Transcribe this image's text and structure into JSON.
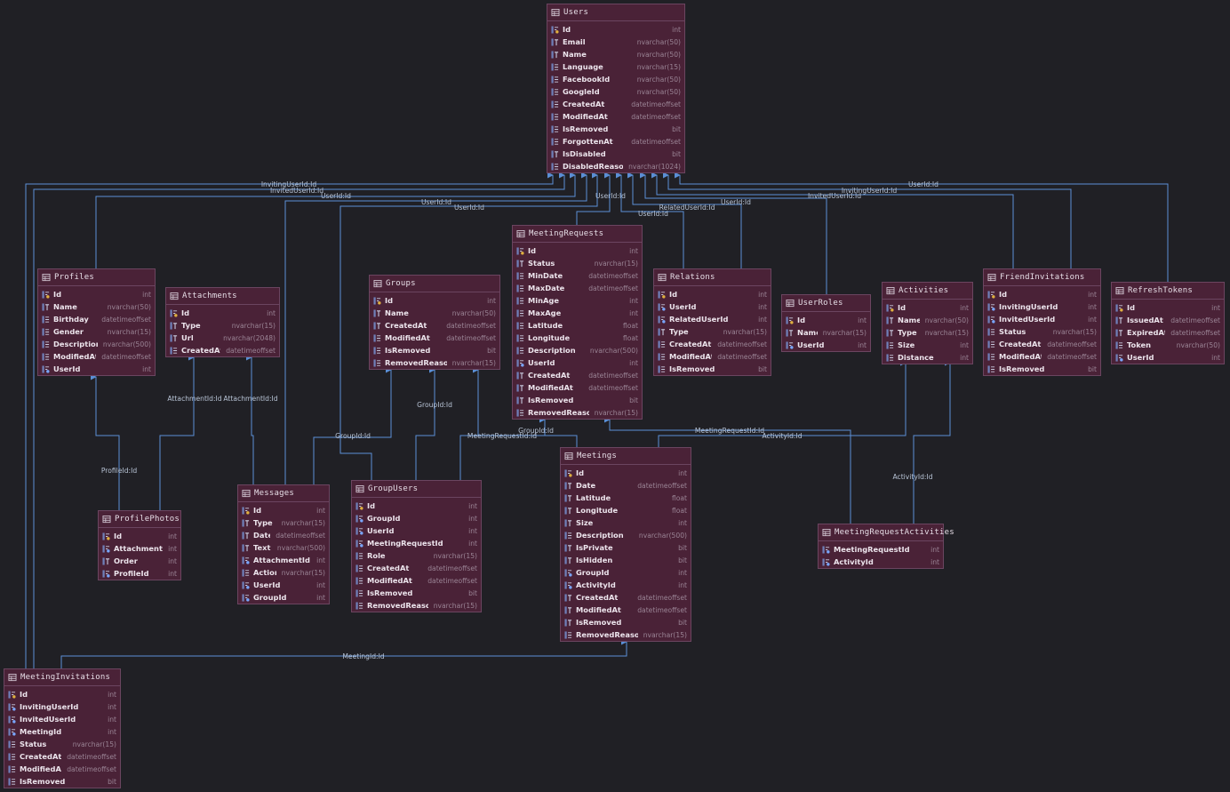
{
  "tables": [
    {
      "key": "users",
      "name": "Users",
      "columns": [
        {
          "name": "Id",
          "type": "int",
          "kind": "pk"
        },
        {
          "name": "Email",
          "type": "nvarchar(50)",
          "kind": "text"
        },
        {
          "name": "Name",
          "type": "nvarchar(50)",
          "kind": "text"
        },
        {
          "name": "Language",
          "type": "nvarchar(15)",
          "kind": "col"
        },
        {
          "name": "FacebookId",
          "type": "nvarchar(50)",
          "kind": "col"
        },
        {
          "name": "GoogleId",
          "type": "nvarchar(50)",
          "kind": "col"
        },
        {
          "name": "CreatedAt",
          "type": "datetimeoffset",
          "kind": "col"
        },
        {
          "name": "ModifiedAt",
          "type": "datetimeoffset",
          "kind": "col"
        },
        {
          "name": "IsRemoved",
          "type": "bit",
          "kind": "col"
        },
        {
          "name": "ForgottenAt",
          "type": "datetimeoffset",
          "kind": "col"
        },
        {
          "name": "IsDisabled",
          "type": "bit",
          "kind": "text"
        },
        {
          "name": "DisabledReason",
          "type": "nvarchar(1024)",
          "kind": "col"
        }
      ]
    },
    {
      "key": "meetingrequests",
      "name": "MeetingRequests",
      "columns": [
        {
          "name": "Id",
          "type": "int",
          "kind": "pk"
        },
        {
          "name": "Status",
          "type": "nvarchar(15)",
          "kind": "text"
        },
        {
          "name": "MinDate",
          "type": "datetimeoffset",
          "kind": "col"
        },
        {
          "name": "MaxDate",
          "type": "datetimeoffset",
          "kind": "col"
        },
        {
          "name": "MinAge",
          "type": "int",
          "kind": "col"
        },
        {
          "name": "MaxAge",
          "type": "int",
          "kind": "col"
        },
        {
          "name": "Latitude",
          "type": "float",
          "kind": "col"
        },
        {
          "name": "Longitude",
          "type": "float",
          "kind": "col"
        },
        {
          "name": "Description",
          "type": "nvarchar(500)",
          "kind": "col"
        },
        {
          "name": "UserId",
          "type": "int",
          "kind": "fk"
        },
        {
          "name": "CreatedAt",
          "type": "datetimeoffset",
          "kind": "text"
        },
        {
          "name": "ModifiedAt",
          "type": "datetimeoffset",
          "kind": "text"
        },
        {
          "name": "IsRemoved",
          "type": "bit",
          "kind": "text"
        },
        {
          "name": "RemovedReason",
          "type": "nvarchar(15)",
          "kind": "col"
        }
      ]
    },
    {
      "key": "profiles",
      "name": "Profiles",
      "columns": [
        {
          "name": "Id",
          "type": "int",
          "kind": "pk"
        },
        {
          "name": "Name",
          "type": "nvarchar(50)",
          "kind": "text"
        },
        {
          "name": "Birthday",
          "type": "datetimeoffset",
          "kind": "col"
        },
        {
          "name": "Gender",
          "type": "nvarchar(15)",
          "kind": "col"
        },
        {
          "name": "Description",
          "type": "nvarchar(500)",
          "kind": "col"
        },
        {
          "name": "ModifiedAt",
          "type": "datetimeoffset",
          "kind": "col"
        },
        {
          "name": "UserId",
          "type": "int",
          "kind": "fk"
        }
      ]
    },
    {
      "key": "attachments",
      "name": "Attachments",
      "columns": [
        {
          "name": "Id",
          "type": "int",
          "kind": "pk"
        },
        {
          "name": "Type",
          "type": "nvarchar(15)",
          "kind": "text"
        },
        {
          "name": "Url",
          "type": "nvarchar(2048)",
          "kind": "text"
        },
        {
          "name": "CreatedAt",
          "type": "datetimeoffset",
          "kind": "col"
        }
      ]
    },
    {
      "key": "groups",
      "name": "Groups",
      "columns": [
        {
          "name": "Id",
          "type": "int",
          "kind": "pk"
        },
        {
          "name": "Name",
          "type": "nvarchar(50)",
          "kind": "text"
        },
        {
          "name": "CreatedAt",
          "type": "datetimeoffset",
          "kind": "text"
        },
        {
          "name": "ModifiedAt",
          "type": "datetimeoffset",
          "kind": "col"
        },
        {
          "name": "IsRemoved",
          "type": "bit",
          "kind": "col"
        },
        {
          "name": "RemovedReason",
          "type": "nvarchar(15)",
          "kind": "col"
        }
      ]
    },
    {
      "key": "relations",
      "name": "Relations",
      "columns": [
        {
          "name": "Id",
          "type": "int",
          "kind": "pk"
        },
        {
          "name": "UserId",
          "type": "int",
          "kind": "fk"
        },
        {
          "name": "RelatedUserId",
          "type": "int",
          "kind": "fk"
        },
        {
          "name": "Type",
          "type": "nvarchar(15)",
          "kind": "text"
        },
        {
          "name": "CreatedAt",
          "type": "datetimeoffset",
          "kind": "col"
        },
        {
          "name": "ModifiedAt",
          "type": "datetimeoffset",
          "kind": "col"
        },
        {
          "name": "IsRemoved",
          "type": "bit",
          "kind": "col"
        }
      ]
    },
    {
      "key": "userroles",
      "name": "UserRoles",
      "columns": [
        {
          "name": "Id",
          "type": "int",
          "kind": "pk"
        },
        {
          "name": "Name",
          "type": "nvarchar(15)",
          "kind": "text"
        },
        {
          "name": "UserId",
          "type": "int",
          "kind": "fk"
        }
      ]
    },
    {
      "key": "activities",
      "name": "Activities",
      "columns": [
        {
          "name": "Id",
          "type": "int",
          "kind": "pk"
        },
        {
          "name": "Name",
          "type": "nvarchar(50)",
          "kind": "text"
        },
        {
          "name": "Type",
          "type": "nvarchar(15)",
          "kind": "text"
        },
        {
          "name": "Size",
          "type": "int",
          "kind": "col"
        },
        {
          "name": "Distance",
          "type": "int",
          "kind": "col"
        }
      ]
    },
    {
      "key": "friendinvitations",
      "name": "FriendInvitations",
      "columns": [
        {
          "name": "Id",
          "type": "int",
          "kind": "pk"
        },
        {
          "name": "InvitingUserId",
          "type": "int",
          "kind": "fk"
        },
        {
          "name": "InvitedUserId",
          "type": "int",
          "kind": "fk"
        },
        {
          "name": "Status",
          "type": "nvarchar(15)",
          "kind": "col"
        },
        {
          "name": "CreatedAt",
          "type": "datetimeoffset",
          "kind": "col"
        },
        {
          "name": "ModifiedAt",
          "type": "datetimeoffset",
          "kind": "col"
        },
        {
          "name": "IsRemoved",
          "type": "bit",
          "kind": "col"
        }
      ]
    },
    {
      "key": "refreshtokens",
      "name": "RefreshTokens",
      "columns": [
        {
          "name": "Id",
          "type": "int",
          "kind": "pk"
        },
        {
          "name": "IssuedAt",
          "type": "datetimeoffset",
          "kind": "text"
        },
        {
          "name": "ExpiredAt",
          "type": "datetimeoffset",
          "kind": "text"
        },
        {
          "name": "Token",
          "type": "nvarchar(50)",
          "kind": "col"
        },
        {
          "name": "UserId",
          "type": "int",
          "kind": "fk"
        }
      ]
    },
    {
      "key": "profilephotos",
      "name": "ProfilePhotos",
      "columns": [
        {
          "name": "Id",
          "type": "int",
          "kind": "pk"
        },
        {
          "name": "AttachmentId",
          "type": "int",
          "kind": "fk"
        },
        {
          "name": "Order",
          "type": "int",
          "kind": "text"
        },
        {
          "name": "ProfileId",
          "type": "int",
          "kind": "fk"
        }
      ]
    },
    {
      "key": "messages",
      "name": "Messages",
      "columns": [
        {
          "name": "Id",
          "type": "int",
          "kind": "pk"
        },
        {
          "name": "Type",
          "type": "nvarchar(15)",
          "kind": "text"
        },
        {
          "name": "Date",
          "type": "datetimeoffset",
          "kind": "text"
        },
        {
          "name": "Text",
          "type": "nvarchar(500)",
          "kind": "text"
        },
        {
          "name": "AttachmentId",
          "type": "int",
          "kind": "fk"
        },
        {
          "name": "Action",
          "type": "nvarchar(15)",
          "kind": "col"
        },
        {
          "name": "UserId",
          "type": "int",
          "kind": "fk"
        },
        {
          "name": "GroupId",
          "type": "int",
          "kind": "fk"
        }
      ]
    },
    {
      "key": "groupusers",
      "name": "GroupUsers",
      "columns": [
        {
          "name": "Id",
          "type": "int",
          "kind": "pk"
        },
        {
          "name": "GroupId",
          "type": "int",
          "kind": "fk"
        },
        {
          "name": "UserId",
          "type": "int",
          "kind": "fk"
        },
        {
          "name": "MeetingRequestId",
          "type": "int",
          "kind": "fk"
        },
        {
          "name": "Role",
          "type": "nvarchar(15)",
          "kind": "col"
        },
        {
          "name": "CreatedAt",
          "type": "datetimeoffset",
          "kind": "col"
        },
        {
          "name": "ModifiedAt",
          "type": "datetimeoffset",
          "kind": "col"
        },
        {
          "name": "IsRemoved",
          "type": "bit",
          "kind": "col"
        },
        {
          "name": "RemovedReason",
          "type": "nvarchar(15)",
          "kind": "col"
        }
      ]
    },
    {
      "key": "meetings",
      "name": "Meetings",
      "columns": [
        {
          "name": "Id",
          "type": "int",
          "kind": "pk"
        },
        {
          "name": "Date",
          "type": "datetimeoffset",
          "kind": "text"
        },
        {
          "name": "Latitude",
          "type": "float",
          "kind": "text"
        },
        {
          "name": "Longitude",
          "type": "float",
          "kind": "text"
        },
        {
          "name": "Size",
          "type": "int",
          "kind": "text"
        },
        {
          "name": "Description",
          "type": "nvarchar(500)",
          "kind": "col"
        },
        {
          "name": "IsPrivate",
          "type": "bit",
          "kind": "text"
        },
        {
          "name": "IsHidden",
          "type": "bit",
          "kind": "text"
        },
        {
          "name": "GroupId",
          "type": "int",
          "kind": "fk"
        },
        {
          "name": "ActivityId",
          "type": "int",
          "kind": "fk"
        },
        {
          "name": "CreatedAt",
          "type": "datetimeoffset",
          "kind": "text"
        },
        {
          "name": "ModifiedAt",
          "type": "datetimeoffset",
          "kind": "text"
        },
        {
          "name": "IsRemoved",
          "type": "bit",
          "kind": "text"
        },
        {
          "name": "RemovedReason",
          "type": "nvarchar(15)",
          "kind": "col"
        }
      ]
    },
    {
      "key": "meetingrequestactivities",
      "name": "MeetingRequestActivities",
      "columns": [
        {
          "name": "MeetingRequestId",
          "type": "int",
          "kind": "fk"
        },
        {
          "name": "ActivityId",
          "type": "int",
          "kind": "fk"
        }
      ]
    },
    {
      "key": "meetinginvitations",
      "name": "MeetingInvitations",
      "columns": [
        {
          "name": "Id",
          "type": "int",
          "kind": "pk"
        },
        {
          "name": "InvitingUserId",
          "type": "int",
          "kind": "fk"
        },
        {
          "name": "InvitedUserId",
          "type": "int",
          "kind": "fk"
        },
        {
          "name": "MeetingId",
          "type": "int",
          "kind": "fk"
        },
        {
          "name": "Status",
          "type": "nvarchar(15)",
          "kind": "col"
        },
        {
          "name": "CreatedAt",
          "type": "datetimeoffset",
          "kind": "col"
        },
        {
          "name": "ModifiedAt",
          "type": "datetimeoffset",
          "kind": "col"
        },
        {
          "name": "IsRemoved",
          "type": "bit",
          "kind": "col"
        }
      ]
    }
  ],
  "relation_labels": [
    {
      "key": "rl-inviting-user-id-1",
      "text": "InvitingUserId:Id"
    },
    {
      "key": "rl-invited-user-id-1",
      "text": "InvitedUserId:Id"
    },
    {
      "key": "rl-user-id-profiles",
      "text": "UserId:Id"
    },
    {
      "key": "rl-user-id-messages",
      "text": "UserId:Id"
    },
    {
      "key": "rl-user-id-groupusers",
      "text": "UserId:Id"
    },
    {
      "key": "rl-user-id-meetingrequests",
      "text": "UserId:Id"
    },
    {
      "key": "rl-user-id-relations",
      "text": "UserId:Id"
    },
    {
      "key": "rl-related-user-id",
      "text": "RelatedUserId:Id"
    },
    {
      "key": "rl-user-id-userroles",
      "text": "UserId:Id"
    },
    {
      "key": "rl-invited-user-id-2",
      "text": "InvitedUserId:Id"
    },
    {
      "key": "rl-inviting-user-id-2",
      "text": "InvitingUserId:Id"
    },
    {
      "key": "rl-user-id-refreshtokens",
      "text": "UserId:Id"
    },
    {
      "key": "rl-attachment-id-1",
      "text": "AttachmentId:Id"
    },
    {
      "key": "rl-attachment-id-2",
      "text": "AttachmentId:Id"
    },
    {
      "key": "rl-group-id-1",
      "text": "GroupId:Id"
    },
    {
      "key": "rl-group-id-2",
      "text": "GroupId:Id"
    },
    {
      "key": "rl-group-id-3",
      "text": "GroupId:Id"
    },
    {
      "key": "rl-meeting-request-id-1",
      "text": "MeetingRequestId:Id"
    },
    {
      "key": "rl-meeting-request-id-2",
      "text": "MeetingRequestId:Id"
    },
    {
      "key": "rl-activity-id-1",
      "text": "ActivityId:Id"
    },
    {
      "key": "rl-activity-id-2",
      "text": "ActivityId:Id"
    },
    {
      "key": "rl-profile-id",
      "text": "ProfileId:Id"
    },
    {
      "key": "rl-meeting-id",
      "text": "MeetingId:Id"
    }
  ],
  "colors": {
    "background": "#202025",
    "table_fill": "#4a2237",
    "table_border": "#6b4560",
    "relation_line": "#5b8fd6",
    "column_name": "#ece4ec",
    "column_type": "#9a8495"
  },
  "icons": {
    "table": "table-icon",
    "primary_key": "key-column-icon",
    "foreign_key": "foreign-key-column-icon",
    "text_column": "text-column-icon",
    "column": "column-icon"
  }
}
